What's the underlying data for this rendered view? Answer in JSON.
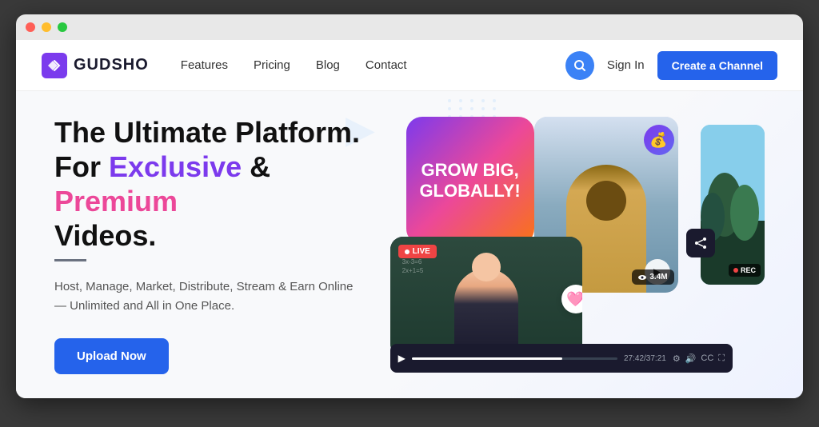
{
  "window": {
    "dots": [
      "red",
      "yellow",
      "green"
    ]
  },
  "navbar": {
    "logo_text": "GUDSHO",
    "nav_links": [
      {
        "label": "Features",
        "id": "features"
      },
      {
        "label": "Pricing",
        "id": "pricing"
      },
      {
        "label": "Blog",
        "id": "blog"
      },
      {
        "label": "Contact",
        "id": "contact"
      }
    ],
    "sign_in_label": "Sign In",
    "create_channel_label": "Create a Channel",
    "search_icon": "🔍"
  },
  "hero": {
    "title_line1": "The Ultimate Platform.",
    "title_line2_prefix": "For ",
    "title_highlight1": "Exclusive",
    "title_separator": " & ",
    "title_highlight2": "Premium",
    "title_line3": "Videos.",
    "subtitle": "Host, Manage, Market, Distribute, Stream & Earn Online — Unlimited and All in One Place.",
    "cta_button": "Upload Now",
    "grow_big_text": "GROW BIG, GLOBALLY!",
    "live_badge": "LIVE",
    "heart_icon": "🩷",
    "play_icon": "▶",
    "stats_label": "3.4M",
    "time_current": "27:42",
    "time_total": "37:21",
    "rec_label": "REC",
    "share_icon": "◁"
  }
}
